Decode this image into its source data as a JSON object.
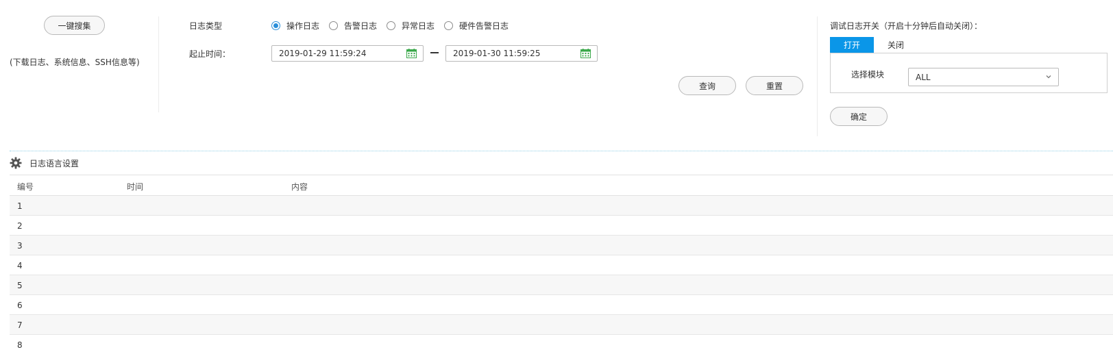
{
  "left": {
    "one_click_label": "一键搜集",
    "desc": "(下载日志、系统信息、SSH信息等)"
  },
  "filters": {
    "log_type_label": "日志类型",
    "radios": [
      {
        "label": "操作日志",
        "checked": true
      },
      {
        "label": "告警日志",
        "checked": false
      },
      {
        "label": "异常日志",
        "checked": false
      },
      {
        "label": "硬件告警日志",
        "checked": false
      }
    ],
    "time_label": "起止时间：",
    "start_time": "2019-01-29 11:59:24",
    "end_time": "2019-01-30 11:59:25",
    "query_label": "查询",
    "reset_label": "重置"
  },
  "debug": {
    "title": "调试日志开关（开启十分钟后自动关闭）：",
    "tab_on": "打开",
    "tab_off": "关闭",
    "module_label": "选择模块",
    "module_value": "ALL",
    "confirm_label": "确定"
  },
  "settings": {
    "lang_label": "日志语言设置"
  },
  "table": {
    "headers": [
      "编号",
      "时间",
      "内容"
    ],
    "rows": [
      "1",
      "2",
      "3",
      "4",
      "5",
      "6",
      "7",
      "8"
    ]
  },
  "colors": {
    "accent": "#0a96e8",
    "calendar": "#3aa84a"
  },
  "icons": {
    "calendar": "calendar-icon",
    "gear": "gear-icon",
    "chevron": "chevron-down-icon"
  }
}
